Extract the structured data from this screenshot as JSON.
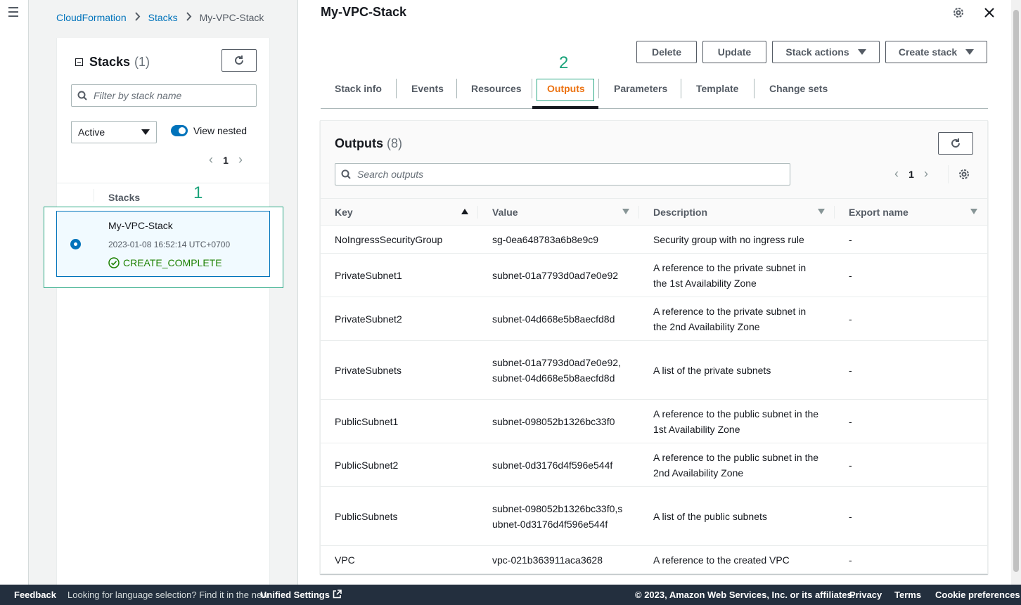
{
  "breadcrumb": [
    "CloudFormation",
    "Stacks",
    "My-VPC-Stack"
  ],
  "stacks_panel": {
    "title": "Stacks",
    "count": "(1)",
    "filter_placeholder": "Filter by stack name",
    "status_filter": "Active",
    "view_nested_label": "View nested",
    "view_nested_on": true,
    "page": "1",
    "column_header": "Stacks",
    "rows": [
      {
        "name": "My-VPC-Stack",
        "date": "2023-01-08 16:52:14 UTC+0700",
        "status": "CREATE_COMPLETE",
        "selected": true
      }
    ]
  },
  "annotations": {
    "a1": "1",
    "a2": "2"
  },
  "main": {
    "title": "My-VPC-Stack",
    "buttons": {
      "delete": "Delete",
      "update": "Update",
      "stack_actions": "Stack actions",
      "create_stack": "Create stack"
    },
    "tabs": [
      "Stack info",
      "Events",
      "Resources",
      "Outputs",
      "Parameters",
      "Template",
      "Change sets"
    ],
    "active_tab": "Outputs"
  },
  "outputs": {
    "title": "Outputs",
    "count": "(8)",
    "search_placeholder": "Search outputs",
    "page": "1",
    "columns": [
      "Key",
      "Value",
      "Description",
      "Export name"
    ],
    "rows": [
      {
        "key": "NoIngressSecurityGroup",
        "value": "sg-0ea648783a6b8e9c9",
        "description": "Security group with no ingress rule",
        "export": "-"
      },
      {
        "key": "PrivateSubnet1",
        "value": "subnet-01a7793d0ad7e0e92",
        "description": "A reference to the private subnet in the 1st Availability Zone",
        "export": "-"
      },
      {
        "key": "PrivateSubnet2",
        "value": "subnet-04d668e5b8aecfd8d",
        "description": "A reference to the private subnet in the 2nd Availability Zone",
        "export": "-"
      },
      {
        "key": "PrivateSubnets",
        "value": "subnet-01a7793d0ad7e0e92,subnet-04d668e5b8aecfd8d",
        "description": "A list of the private subnets",
        "export": "-"
      },
      {
        "key": "PublicSubnet1",
        "value": "subnet-098052b1326bc33f0",
        "description": "A reference to the public subnet in the 1st Availability Zone",
        "export": "-"
      },
      {
        "key": "PublicSubnet2",
        "value": "subnet-0d3176d4f596e544f",
        "description": "A reference to the public subnet in the 2nd Availability Zone",
        "export": "-"
      },
      {
        "key": "PublicSubnets",
        "value": "subnet-098052b1326bc33f0,subnet-0d3176d4f596e544f",
        "description": "A list of the public subnets",
        "export": "-"
      },
      {
        "key": "VPC",
        "value": "vpc-021b363911aca3628",
        "description": "A reference to the created VPC",
        "export": "-"
      }
    ]
  },
  "footer": {
    "feedback": "Feedback",
    "language_text": "Looking for language selection? Find it in the new",
    "unified_settings": "Unified Settings",
    "copyright": "© 2023, Amazon Web Services, Inc. or its affiliates.",
    "privacy": "Privacy",
    "terms": "Terms",
    "cookies": "Cookie preferences"
  },
  "colors": {
    "link": "#0073bb",
    "active_tab": "#ec7211",
    "success": "#1d8102",
    "annotation": "#1aa37a",
    "footer_bg": "#232f3e"
  }
}
